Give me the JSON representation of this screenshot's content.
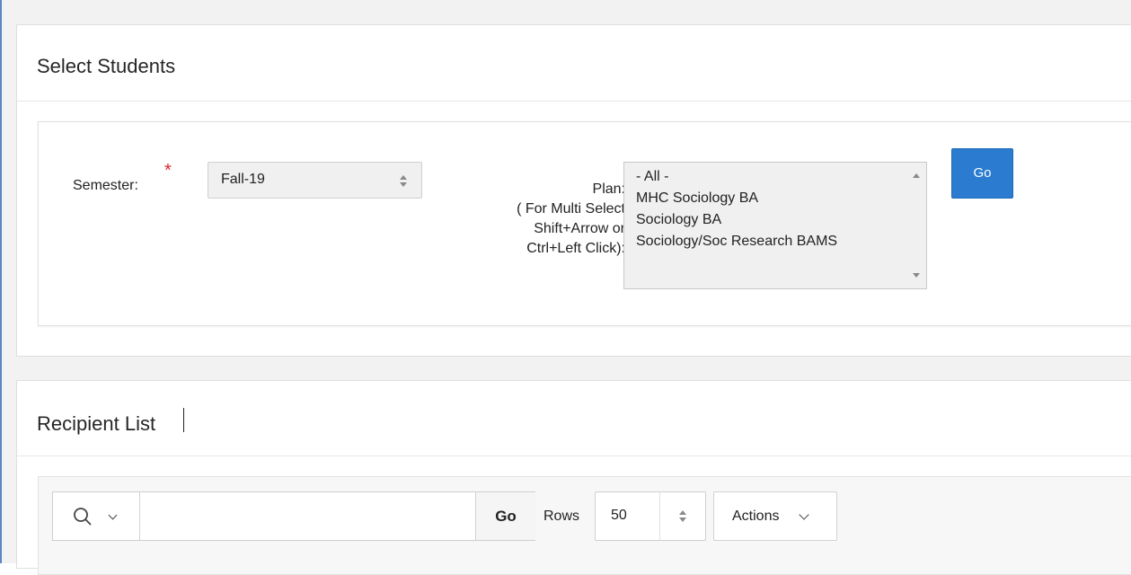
{
  "select_students": {
    "title": "Select Students",
    "semester_label": "Semester:",
    "semester_value": "Fall-19",
    "plan_label": [
      "Plan:",
      "( For Multi Select",
      "Shift+Arrow or",
      "Ctrl+Left Click):"
    ],
    "plan_options": [
      "- All -",
      "MHC Sociology BA",
      "Sociology BA",
      "Sociology/Soc Research BAMS"
    ],
    "go_label": "Go"
  },
  "recipient_list": {
    "title": "Recipient List",
    "search_value": "",
    "go_label": "Go",
    "rows_label": "Rows",
    "rows_value": "50",
    "actions_label": "Actions"
  },
  "colors": {
    "primary": "#2b7bd0",
    "required": "#e0262b",
    "accent_border": "#5b87c5"
  }
}
